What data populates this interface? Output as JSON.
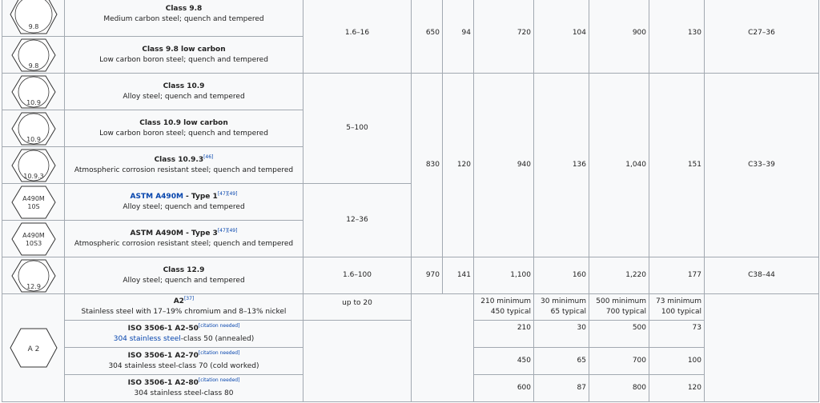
{
  "rows": [
    {
      "mark": "9.8",
      "title": "Class 9.8",
      "desc": "Medium carbon steel; quench and tempered"
    },
    {
      "mark": "9.8",
      "title": "Class 9.8 low carbon",
      "desc": "Low carbon boron steel; quench and tempered"
    },
    {
      "mark": "10.9",
      "title": "Class 10.9",
      "desc": "Alloy steel; quench and tempered"
    },
    {
      "mark": "10.9",
      "title": "Class 10.9 low carbon",
      "desc": "Low carbon boron steel; quench and tempered"
    },
    {
      "mark": "10.9.3",
      "title": "Class 10.9.3",
      "ref": "[46]",
      "desc": "Atmospheric corrosion resistant steel; quench and tempered"
    },
    {
      "mark": [
        "A490M",
        "10S"
      ],
      "title_link": "ASTM A490M",
      "title": " - Type 1",
      "ref": "[47][49]",
      "desc": "Alloy steel; quench and tempered"
    },
    {
      "mark": [
        "A490M",
        "10S3"
      ],
      "title": "ASTM A490M - Type 3",
      "ref": "[47][49]",
      "desc": "Atmospheric corrosion resistant steel; quench and tempered"
    },
    {
      "mark": "12.9",
      "title": "Class 12.9",
      "desc": "Alloy steel; quench and tempered"
    }
  ],
  "groups": {
    "class98": {
      "size": "1.6–16",
      "proof_mpa": "650",
      "proof_ksi": "94",
      "yield_mpa": "720",
      "yield_ksi": "104",
      "tensile_mpa": "900",
      "tensile_ksi": "130",
      "hardness": "C27–36"
    },
    "class109": {
      "size_a": "5–100",
      "size_b": "12–36",
      "proof_mpa": "830",
      "proof_ksi": "120",
      "yield_mpa": "940",
      "yield_ksi": "136",
      "tensile_mpa": "1,040",
      "tensile_ksi": "151",
      "hardness": "C33–39"
    },
    "class129": {
      "size": "1.6–100",
      "proof_mpa": "970",
      "proof_ksi": "141",
      "yield_mpa": "1,100",
      "yield_ksi": "160",
      "tensile_mpa": "1,220",
      "tensile_ksi": "177",
      "hardness": "C38–44"
    }
  },
  "a2": {
    "mark": "A 2",
    "size": "up to 20",
    "head": {
      "title": "A2",
      "ref": "[37]",
      "desc": "Stainless steel with 17–19% chromium and 8–13% nickel",
      "yield_mpa": [
        "210 minimum",
        "450 typical"
      ],
      "yield_ksi": [
        "30 minimum",
        "65 typical"
      ],
      "tensile_mpa": [
        "500 minimum",
        "700 typical"
      ],
      "tensile_ksi": [
        "73 minimum",
        "100 typical"
      ]
    },
    "subs": [
      {
        "title": "ISO 3506-1 A2-50",
        "cite": "[citation needed]",
        "desc_link": "304 stainless steel",
        "desc": "-class 50 (annealed)",
        "yield_mpa": "210",
        "yield_ksi": "30",
        "tensile_mpa": "500",
        "tensile_ksi": "73"
      },
      {
        "title": "ISO 3506-1 A2-70",
        "cite": "[citation needed]",
        "desc": "304 stainless steel-class 70 (cold worked)",
        "yield_mpa": "450",
        "yield_ksi": "65",
        "tensile_mpa": "700",
        "tensile_ksi": "100"
      },
      {
        "title": "ISO 3506-1 A2-80",
        "cite": "[citation needed]",
        "desc": "304 stainless steel-class 80",
        "yield_mpa": "600",
        "yield_ksi": "87",
        "tensile_mpa": "800",
        "tensile_ksi": "120"
      }
    ]
  }
}
